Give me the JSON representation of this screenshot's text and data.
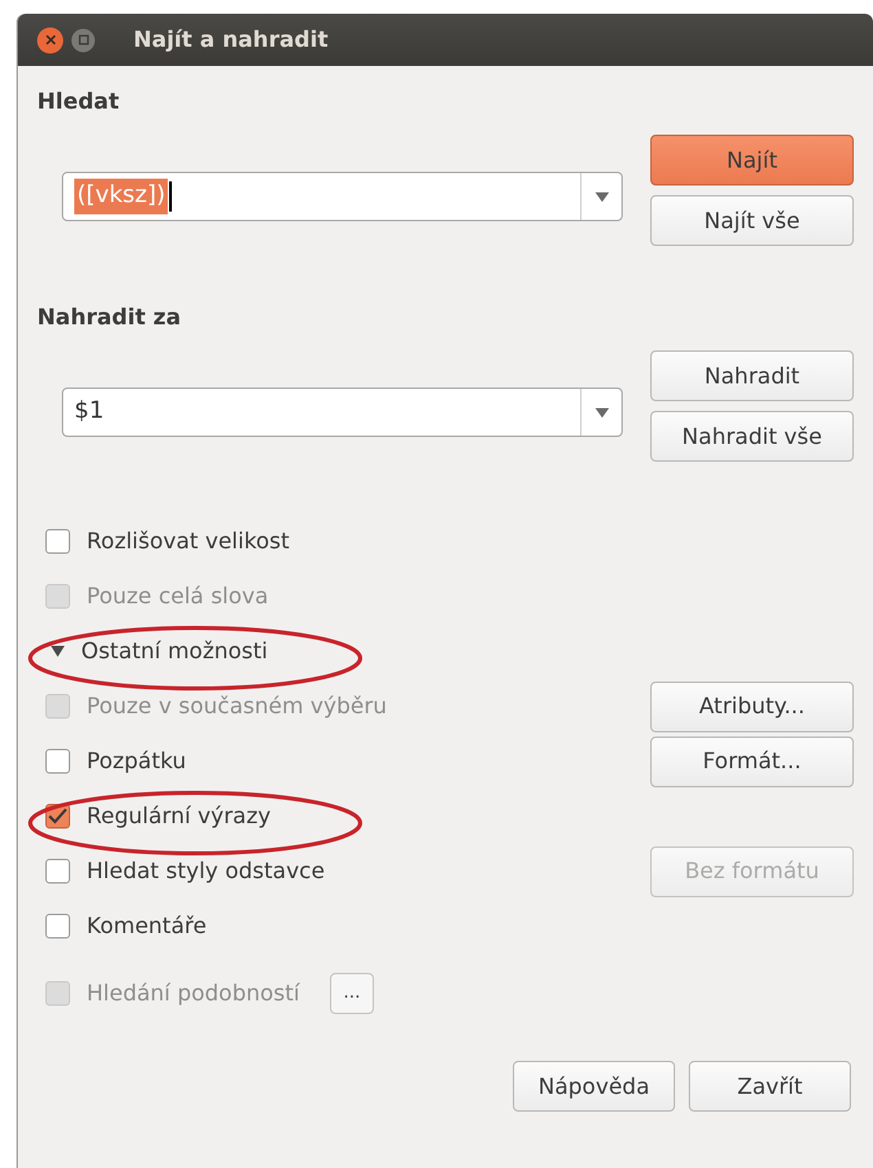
{
  "window": {
    "title": "Najít a nahradit"
  },
  "search": {
    "heading": "Hledat",
    "value": "([vksz])",
    "value_selected": true,
    "buttons": [
      {
        "label": "Najít",
        "primary": true
      },
      {
        "label": "Najít vše",
        "primary": false
      }
    ]
  },
  "replace": {
    "heading": "Nahradit za",
    "value": "$1",
    "value_selected": false,
    "buttons": [
      {
        "label": "Nahradit",
        "primary": false
      },
      {
        "label": "Nahradit vše",
        "primary": false
      }
    ]
  },
  "options": [
    {
      "kind": "checkbox",
      "label": "Rozlišovat velikost",
      "checked": false,
      "disabled": false,
      "circled": false
    },
    {
      "kind": "checkbox",
      "label": "Pouze celá slova",
      "checked": false,
      "disabled": true,
      "circled": false
    },
    {
      "kind": "expander",
      "label": "Ostatní možnosti",
      "expanded": true,
      "circled": true
    },
    {
      "kind": "checkbox",
      "label": "Pouze v současném výběru",
      "checked": false,
      "disabled": true,
      "circled": false,
      "button": {
        "label": "Atributy...",
        "disabled": false
      }
    },
    {
      "kind": "checkbox",
      "label": "Pozpátku",
      "checked": false,
      "disabled": false,
      "circled": false,
      "button": {
        "label": "Formát...",
        "disabled": false
      }
    },
    {
      "kind": "checkbox",
      "label": "Regulární výrazy",
      "checked": true,
      "disabled": false,
      "circled": true
    },
    {
      "kind": "checkbox",
      "label": "Hledat styly odstavce",
      "checked": false,
      "disabled": false,
      "circled": false,
      "button": {
        "label": "Bez formátu",
        "disabled": true
      }
    },
    {
      "kind": "checkbox",
      "label": "Komentáře",
      "checked": false,
      "disabled": false,
      "circled": false
    },
    {
      "kind": "checkbox",
      "label": "Hledání podobností",
      "checked": false,
      "disabled": true,
      "circled": false,
      "inline_button": "..."
    }
  ],
  "footer_buttons": [
    "Nápověda",
    "Zavřít"
  ]
}
